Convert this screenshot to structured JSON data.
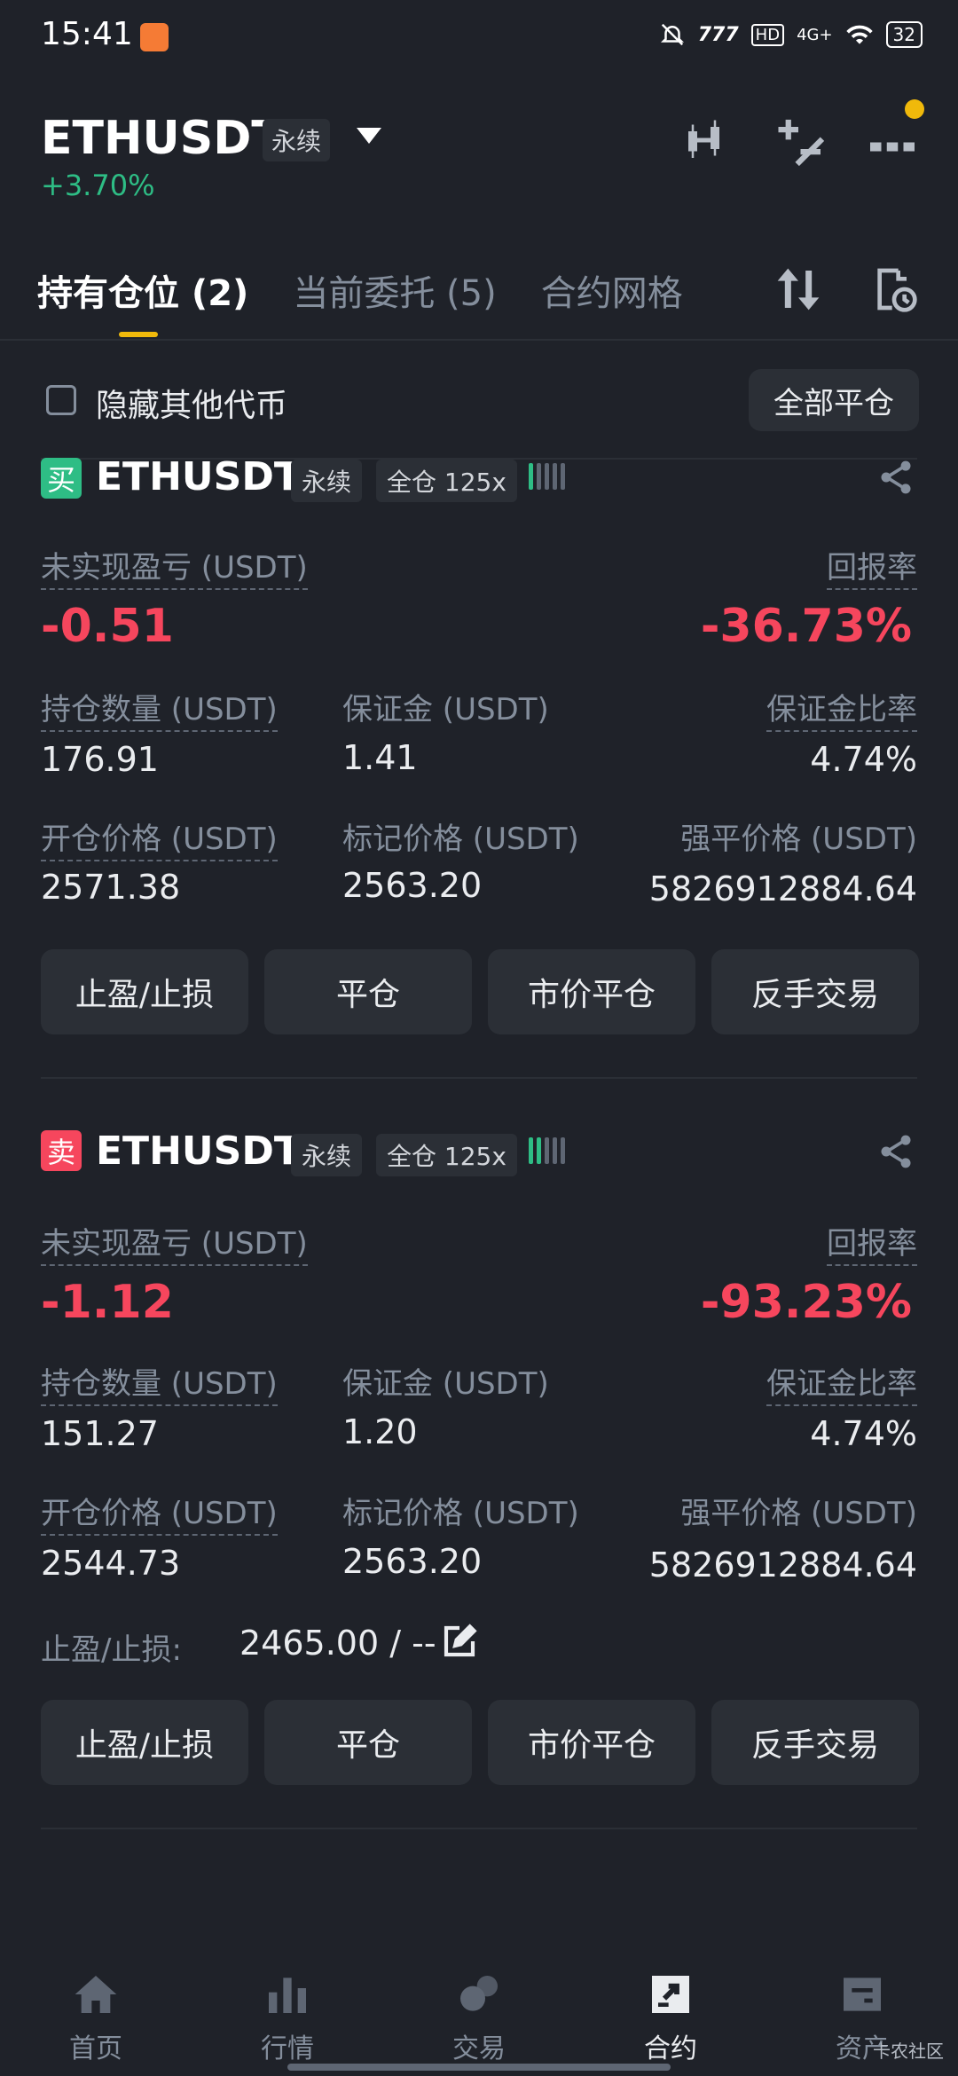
{
  "status_bar": {
    "time": "15:41",
    "battery": "32",
    "network": "4G+",
    "speed": "777",
    "hd": "HD"
  },
  "header": {
    "symbol": "ETHUSDT",
    "contract_tag": "永续",
    "change": "+3.70%",
    "icons": [
      "candlestick-icon",
      "plus-minus-icon",
      "more-icon"
    ],
    "accent": "#f0b90b"
  },
  "tabs": [
    {
      "label": "持有仓位 (2)",
      "active": true
    },
    {
      "label": "当前委托 (5)",
      "active": false
    },
    {
      "label": "合约网格",
      "active": false
    }
  ],
  "filter": {
    "hide_label": "隐藏其他代币",
    "close_all_label": "全部平仓"
  },
  "positions": [
    {
      "side": "买",
      "symbol": "ETHUSDT",
      "contract_tag": "永续",
      "margin_tag": "全仓 125x",
      "pnl_label": "未实现盈亏 (USDT)",
      "pnl_value": "-0.51",
      "roe_label": "回报率",
      "roe_value": "-36.73%",
      "size_label": "持仓数量 (USDT)",
      "size_value": "176.91",
      "margin_label": "保证金 (USDT)",
      "margin_value": "1.41",
      "margin_ratio_label": "保证金比率",
      "margin_ratio_value": "4.74%",
      "entry_label": "开仓价格 (USDT)",
      "entry_value": "2571.38",
      "mark_label": "标记价格 (USDT)",
      "mark_value": "2563.20",
      "liq_label": "强平价格 (USDT)",
      "liq_value": "5826912884.64",
      "buttons": [
        "止盈/止损",
        "平仓",
        "市价平仓",
        "反手交易"
      ]
    },
    {
      "side": "卖",
      "symbol": "ETHUSDT",
      "contract_tag": "永续",
      "margin_tag": "全仓 125x",
      "pnl_label": "未实现盈亏 (USDT)",
      "pnl_value": "-1.12",
      "roe_label": "回报率",
      "roe_value": "-93.23%",
      "size_label": "持仓数量 (USDT)",
      "size_value": "151.27",
      "margin_label": "保证金 (USDT)",
      "margin_value": "1.20",
      "margin_ratio_label": "保证金比率",
      "margin_ratio_value": "4.74%",
      "entry_label": "开仓价格 (USDT)",
      "entry_value": "2544.73",
      "mark_label": "标记价格 (USDT)",
      "mark_value": "2563.20",
      "liq_label": "强平价格 (USDT)",
      "liq_value": "5826912884.64",
      "tpsl_label": "止盈/止损:",
      "tpsl_value": "2465.00 / --",
      "buttons": [
        "止盈/止损",
        "平仓",
        "市价平仓",
        "反手交易"
      ]
    }
  ],
  "bottom_nav": [
    {
      "label": "首页",
      "icon": "home-icon"
    },
    {
      "label": "行情",
      "icon": "markets-icon"
    },
    {
      "label": "交易",
      "icon": "trade-icon"
    },
    {
      "label": "合约",
      "icon": "futures-icon",
      "active": true
    },
    {
      "label": "资产",
      "icon": "wallet-icon"
    }
  ],
  "watermark": "卡农社区",
  "colors": {
    "background": "#1f2229",
    "green": "#2ebd85",
    "red": "#f6465d",
    "yellow": "#f0b90b"
  }
}
